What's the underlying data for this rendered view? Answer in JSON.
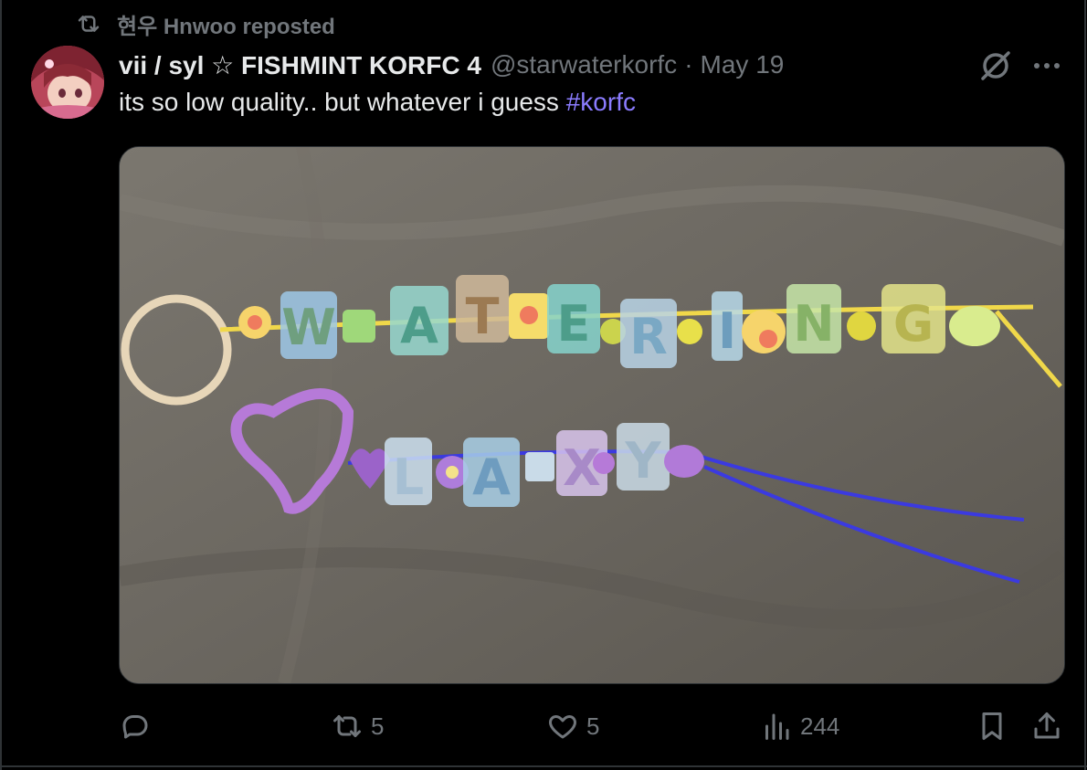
{
  "repost": {
    "text": "현우 Hnwoo reposted"
  },
  "author": {
    "display_name": "vii / syl ☆ FISHMINT KORFC 4",
    "handle": "@starwaterkorfc",
    "separator": "·",
    "date": "May 19"
  },
  "tweet": {
    "text": "its so low quality.. but whatever i guess ",
    "hashtag": "#korfc"
  },
  "media": {
    "keychain_top_letters": [
      "W",
      "A",
      "T",
      "E",
      "R",
      "I",
      "N",
      "G"
    ],
    "keychain_bottom_letters": [
      "L",
      "A",
      "X",
      "Y"
    ]
  },
  "actions": {
    "reply_count": "",
    "repost_count": "5",
    "like_count": "5",
    "views_count": "244"
  },
  "colors": {
    "background": "#000000",
    "text": "#e7e9ea",
    "secondary": "#71767b",
    "hashtag": "#8b7cff"
  }
}
